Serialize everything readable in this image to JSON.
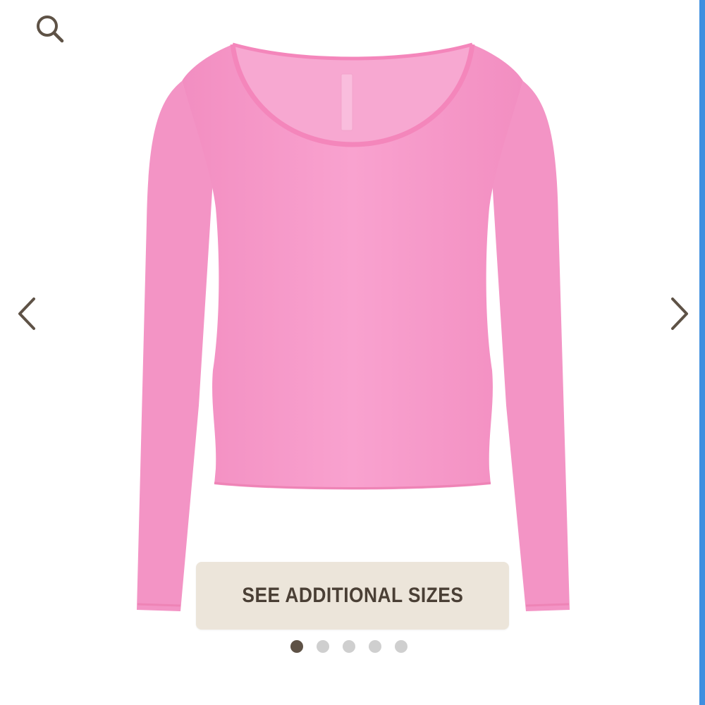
{
  "colors": {
    "accent": "#5e5246",
    "button_background": "#ece5da",
    "button_text": "#4a3f35",
    "product": "#f79ac9",
    "product_trim": "#f486bb",
    "dot_inactive": "#cfcfcf"
  },
  "header": {
    "search_icon": "search-icon"
  },
  "carousel": {
    "prev_icon": "chevron-left-icon",
    "next_icon": "chevron-right-icon",
    "image_count": 5,
    "active_index": 0
  },
  "sizes_button": {
    "label": "SEE ADDITIONAL SIZES"
  }
}
